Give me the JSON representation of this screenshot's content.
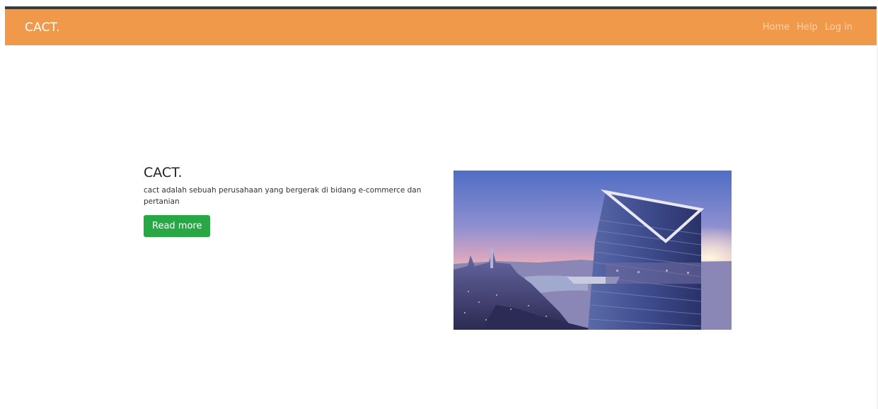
{
  "navbar": {
    "brand": "CACT.",
    "links": [
      "Home",
      "Help",
      "Log in"
    ]
  },
  "hero": {
    "title": "CACT.",
    "description": "cact adalah sebuah perusahaan yang bergerak di bidang e-commerce dan pertanian",
    "button_label": "Read more"
  },
  "colors": {
    "navbar_bg": "#f0994a",
    "button_bg": "#28a745"
  }
}
